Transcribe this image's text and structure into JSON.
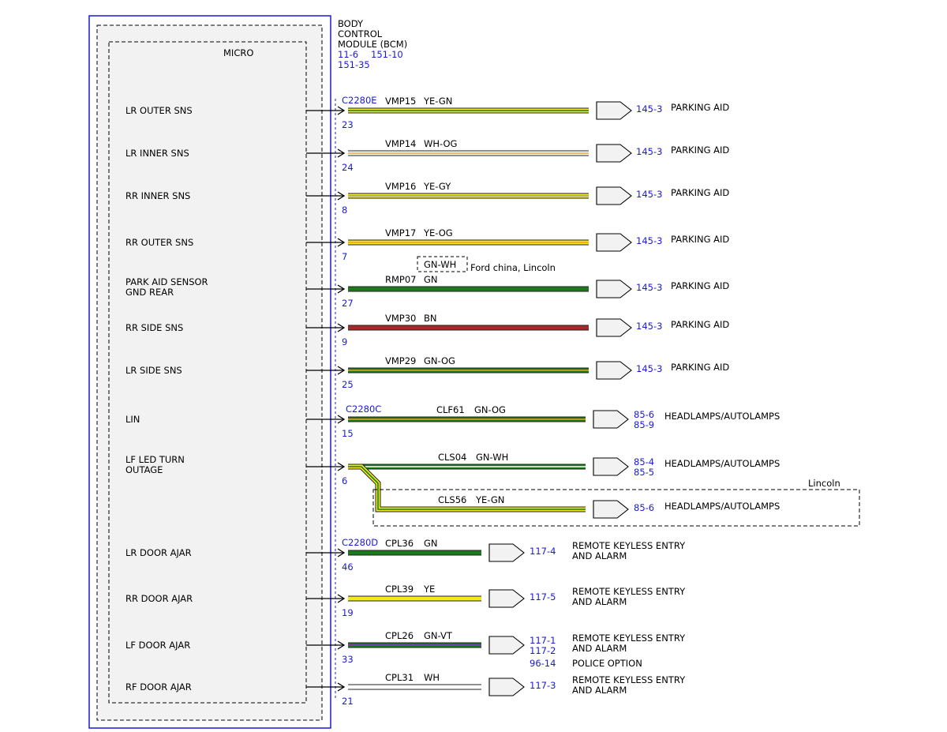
{
  "module": {
    "name_lines": [
      "BODY",
      "CONTROL",
      "MODULE (BCM)"
    ],
    "refs_line1": [
      "11-6",
      "151-10"
    ],
    "refs_line2": "151-35",
    "inner_label": "MICRO"
  },
  "colors": {
    "module_border": "#1a1ad4",
    "ref_text": "#1a1ad4",
    "YE": "#f2ea1c",
    "GN": "#1c7a1c",
    "WH": "#ffffff",
    "OG": "#f0a020",
    "GY": "#9a9a9a",
    "BN": "#a52a2a",
    "VT": "#8a2be2"
  },
  "connectors": [
    {
      "id": "C2280E"
    },
    {
      "id": "C2280C"
    },
    {
      "id": "C2280D"
    }
  ],
  "circuits": [
    {
      "signal": [
        "LR OUTER SNS"
      ],
      "pin": "23",
      "circuit": "VMP15",
      "wire": "YE-GN",
      "base": "YE",
      "stripe": "GN",
      "refs": [
        "145-3"
      ],
      "dest": [
        "PARKING AID"
      ],
      "connector_label": "C2280E"
    },
    {
      "signal": [
        "LR INNER SNS"
      ],
      "pin": "24",
      "circuit": "VMP14",
      "wire": "WH-OG",
      "base": "WH",
      "stripe": "OG",
      "refs": [
        "145-3"
      ],
      "dest": [
        "PARKING AID"
      ]
    },
    {
      "signal": [
        "RR INNER SNS"
      ],
      "pin": "8",
      "circuit": "VMP16",
      "wire": "YE-GY",
      "base": "YE",
      "stripe": "GY",
      "refs": [
        "145-3"
      ],
      "dest": [
        "PARKING AID"
      ]
    },
    {
      "signal": [
        "RR OUTER SNS"
      ],
      "pin": "7",
      "circuit": "VMP17",
      "wire": "YE-OG",
      "base": "YE",
      "stripe": "OG",
      "refs": [
        "145-3"
      ],
      "dest": [
        "PARKING AID"
      ]
    },
    {
      "signal": [
        "PARK AID SENSOR",
        "GND REAR"
      ],
      "pin": "27",
      "circuit": "RMP07",
      "wire": "GN",
      "base": "GN",
      "stripe": null,
      "refs": [
        "145-3"
      ],
      "dest": [
        "PARKING AID"
      ]
    },
    {
      "signal": [
        "RR SIDE SNS"
      ],
      "pin": "9",
      "circuit": "VMP30",
      "wire": "BN",
      "base": "BN",
      "stripe": null,
      "refs": [
        "145-3"
      ],
      "dest": [
        "PARKING AID"
      ]
    },
    {
      "signal": [
        "LR SIDE SNS"
      ],
      "pin": "25",
      "circuit": "VMP29",
      "wire": "GN-OG",
      "base": "GN",
      "stripe": "OG",
      "refs": [
        "145-3"
      ],
      "dest": [
        "PARKING AID"
      ]
    },
    {
      "signal": [
        "LIN"
      ],
      "pin": "15",
      "circuit": "CLF61",
      "wire": "GN-OG",
      "base": "GN",
      "stripe": "OG",
      "refs": [
        "85-6",
        "85-9"
      ],
      "dest": [
        "HEADLAMPS/AUTOLAMPS"
      ],
      "connector_label": "C2280C"
    },
    {
      "signal": [
        "LF LED TURN",
        "OUTAGE"
      ],
      "pin": "6",
      "circuit": "CLS04",
      "wire": "GN-WH",
      "base": "GN",
      "stripe": "WH",
      "refs": [
        "85-4",
        "85-5"
      ],
      "dest": [
        "HEADLAMPS/AUTOLAMPS"
      ]
    },
    {
      "signal": [],
      "pin": "",
      "circuit": "CLS56",
      "wire": "YE-GN",
      "base": "YE",
      "stripe": "GN",
      "refs": [
        "85-6"
      ],
      "dest": [
        "HEADLAMPS/AUTOLAMPS"
      ]
    },
    {
      "signal": [
        "LR DOOR AJAR"
      ],
      "pin": "46",
      "circuit": "CPL36",
      "wire": "GN",
      "base": "GN",
      "stripe": null,
      "refs": [
        "117-4"
      ],
      "dest": [
        "REMOTE KEYLESS ENTRY",
        "AND ALARM"
      ],
      "connector_label": "C2280D"
    },
    {
      "signal": [
        "RR DOOR AJAR"
      ],
      "pin": "19",
      "circuit": "CPL39",
      "wire": "YE",
      "base": "YE",
      "stripe": null,
      "refs": [
        "117-5"
      ],
      "dest": [
        "REMOTE KEYLESS ENTRY",
        "AND ALARM"
      ]
    },
    {
      "signal": [
        "LF DOOR AJAR"
      ],
      "pin": "33",
      "circuit": "CPL26",
      "wire": "GN-VT",
      "base": "GN",
      "stripe": "VT",
      "refs": [
        "117-1",
        "117-2"
      ],
      "dest": [
        "REMOTE KEYLESS ENTRY",
        "AND ALARM"
      ]
    },
    {
      "signal": [
        "RF DOOR AJAR"
      ],
      "pin": "21",
      "circuit": "CPL31",
      "wire": "WH",
      "base": "WH",
      "stripe": null,
      "refs": [
        "117-3"
      ],
      "dest": [
        "REMOTE KEYLESS ENTRY",
        "AND ALARM"
      ]
    }
  ],
  "variant_note": {
    "wire": "GN-WH",
    "text": "Ford china, Lincoln"
  },
  "option_box_label": "Lincoln",
  "extra_ref": {
    "ref": "96-14",
    "text": "POLICE OPTION"
  }
}
